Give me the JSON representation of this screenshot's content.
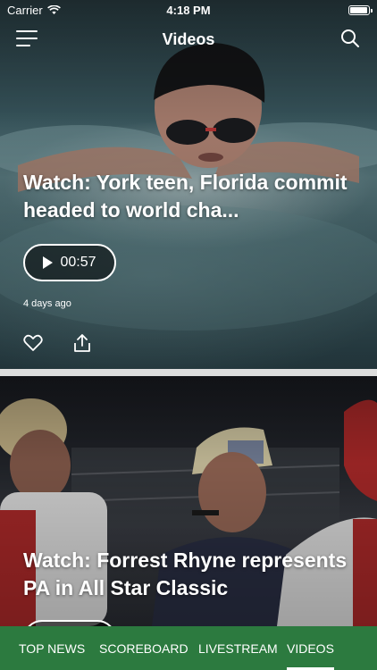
{
  "status_bar": {
    "carrier": "Carrier",
    "time": "4:18 PM",
    "battery_level": 1.0
  },
  "header": {
    "title": "Videos",
    "menu_icon": "hamburger-menu-icon",
    "search_icon": "search-icon"
  },
  "videos": [
    {
      "title": "Watch: York teen, Florida commit headed to world cha...",
      "duration": "00:57",
      "age": "4 days ago"
    },
    {
      "title": "Watch: Forrest Rhyne represents PA in All Star Classic",
      "duration": "",
      "age": ""
    }
  ],
  "tabs": [
    {
      "label": "TOP NEWS",
      "active": false
    },
    {
      "label": "SCOREBOARD",
      "active": false
    },
    {
      "label": "LIVESTREAM",
      "active": false
    },
    {
      "label": "VIDEOS",
      "active": true
    }
  ],
  "colors": {
    "tab_bar": "#2c7a3f",
    "text": "#ffffff"
  }
}
